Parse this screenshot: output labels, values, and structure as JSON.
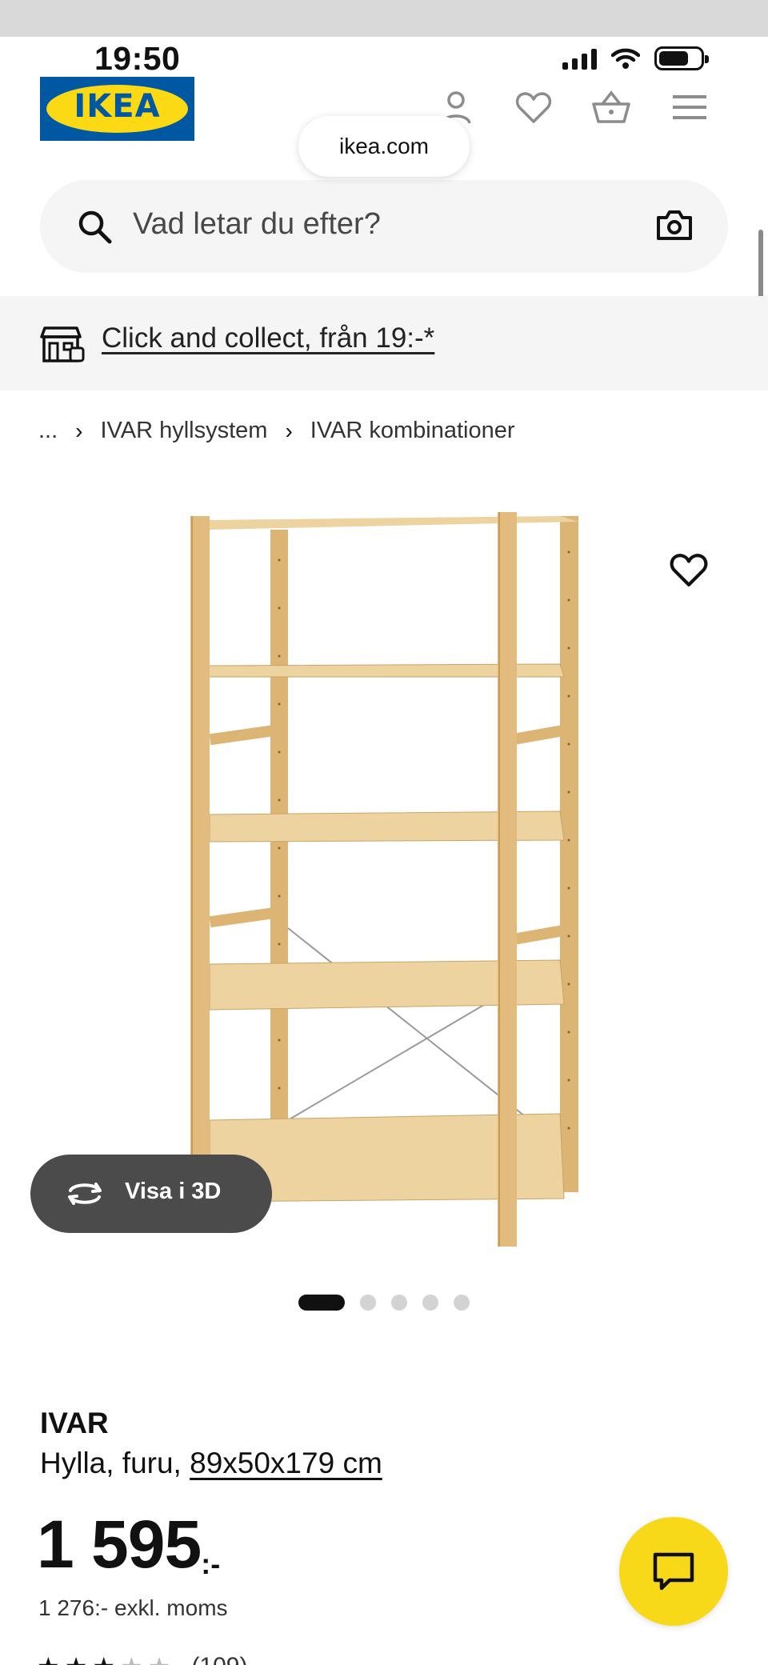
{
  "status_bar": {
    "time": "19:50"
  },
  "header": {
    "logo_text": "IKEA",
    "url": "ikea.com"
  },
  "search": {
    "placeholder": "Vad letar du efter?"
  },
  "banner": {
    "text": "Click and collect, från 19:-*"
  },
  "breadcrumb": {
    "items": [
      "...",
      "IVAR hyllsystem",
      "IVAR kombinationer"
    ]
  },
  "media": {
    "view3d_label": "Visa i 3D",
    "image_count": 5,
    "active_index": 0
  },
  "product": {
    "name": "IVAR",
    "description": "Hylla, furu,",
    "dimensions": "89x50x179 cm",
    "price": "1 595",
    "price_suffix": ":-",
    "price_ex_vat": "1 276:- exkl. moms",
    "rating_count": "(109)",
    "rating": 3
  },
  "colors": {
    "brand_blue": "#0058a3",
    "brand_yellow": "#fbd914",
    "chat_yellow": "#f8d91a",
    "pine": "#e9c98b"
  }
}
